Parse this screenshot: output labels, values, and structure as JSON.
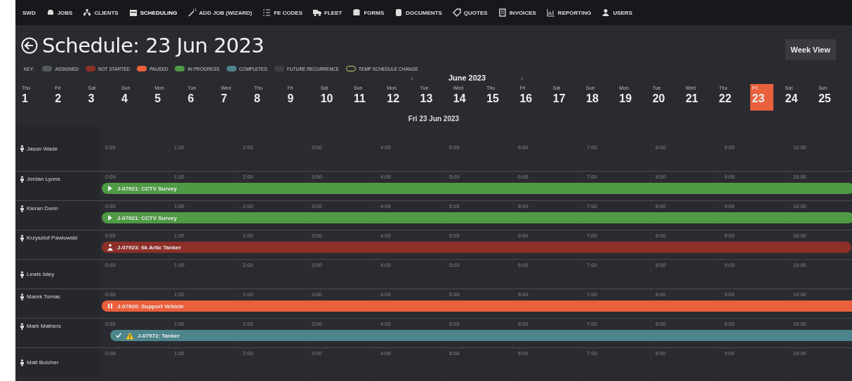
{
  "nav": {
    "brand": "SWD",
    "items": [
      {
        "label": "JOBS",
        "selected": false
      },
      {
        "label": "CLIENTS",
        "selected": false
      },
      {
        "label": "SCHEDULING",
        "selected": true
      },
      {
        "label": "ADD JOB (WIZARD)",
        "selected": false
      },
      {
        "label": "FE CODES",
        "selected": false
      },
      {
        "label": "FLEET",
        "selected": false
      },
      {
        "label": "FORMS",
        "selected": false
      },
      {
        "label": "DOCUMENTS",
        "selected": false
      },
      {
        "label": "QUOTES",
        "selected": false
      },
      {
        "label": "INVOICES",
        "selected": false
      },
      {
        "label": "REPORTING",
        "selected": false
      },
      {
        "label": "USERS",
        "selected": false
      }
    ]
  },
  "header": {
    "title": "Schedule: 23 Jun 2023",
    "view_button": "Week View"
  },
  "legend": {
    "label": "KEY:",
    "items": [
      {
        "label": "ASSIGNED",
        "kind": "fill",
        "color": "#55585e"
      },
      {
        "label": "NOT STARTED",
        "kind": "fill",
        "color": "#8e2f28"
      },
      {
        "label": "PAUSED",
        "kind": "fill",
        "color": "#ea5f3c"
      },
      {
        "label": "IN PROGRESS",
        "kind": "fill",
        "color": "#4f9a45"
      },
      {
        "label": "COMPLETED",
        "kind": "fill",
        "color": "#4d858c"
      },
      {
        "label": "FUTURE RECURRENCE",
        "kind": "fill",
        "color": "#3e4046"
      },
      {
        "label": "TEMP SCHEDULE CHANGE",
        "kind": "outline",
        "color": "#c9c86a"
      }
    ]
  },
  "calendar": {
    "month": "June 2023",
    "prev": "‹",
    "next": "›",
    "days": [
      {
        "weekday": "Thu",
        "day": "1",
        "selected": false
      },
      {
        "weekday": "Fri",
        "day": "2",
        "selected": false
      },
      {
        "weekday": "Sat",
        "day": "3",
        "selected": false
      },
      {
        "weekday": "Sun",
        "day": "4",
        "selected": false
      },
      {
        "weekday": "Mon",
        "day": "5",
        "selected": false
      },
      {
        "weekday": "Tue",
        "day": "6",
        "selected": false
      },
      {
        "weekday": "Wed",
        "day": "7",
        "selected": false
      },
      {
        "weekday": "Thu",
        "day": "8",
        "selected": false
      },
      {
        "weekday": "Fri",
        "day": "9",
        "selected": false
      },
      {
        "weekday": "Sat",
        "day": "10",
        "selected": false
      },
      {
        "weekday": "Sun",
        "day": "11",
        "selected": false
      },
      {
        "weekday": "Mon",
        "day": "12",
        "selected": false
      },
      {
        "weekday": "Tue",
        "day": "13",
        "selected": false
      },
      {
        "weekday": "Wed",
        "day": "14",
        "selected": false
      },
      {
        "weekday": "Thu",
        "day": "15",
        "selected": false
      },
      {
        "weekday": "Fri",
        "day": "16",
        "selected": false
      },
      {
        "weekday": "Sat",
        "day": "17",
        "selected": false
      },
      {
        "weekday": "Sun",
        "day": "18",
        "selected": false
      },
      {
        "weekday": "Mon",
        "day": "19",
        "selected": false
      },
      {
        "weekday": "Tue",
        "day": "20",
        "selected": false
      },
      {
        "weekday": "Wed",
        "day": "21",
        "selected": false
      },
      {
        "weekday": "Thu",
        "day": "22",
        "selected": false
      },
      {
        "weekday": "Fri",
        "day": "23",
        "selected": true
      },
      {
        "weekday": "Sat",
        "day": "24",
        "selected": false
      },
      {
        "weekday": "Sun",
        "day": "25",
        "selected": false
      }
    ],
    "date_label": "Fri 23 Jun 2023"
  },
  "rows": [
    {
      "name": "Jason Wade",
      "hours": [
        "0:00",
        "1:00",
        "2:00",
        "3:00",
        "4:00",
        "5:00",
        "6:00",
        "7:00",
        "8:00",
        "9:00",
        "10:00"
      ]
    },
    {
      "name": "Jordan Lyons",
      "hours": [
        "0:00",
        "1:00",
        "2:00",
        "3:00",
        "4:00",
        "5:00",
        "6:00",
        "7:00",
        "8:00",
        "9:00",
        "10:00"
      ],
      "job": {
        "label": "J-07921: CCTV Survey",
        "kind": "in_progress",
        "warning": false
      }
    },
    {
      "name": "Kieran Dunn",
      "hours": [
        "0:00",
        "1:00",
        "2:00",
        "3:00",
        "4:00",
        "5:00",
        "6:00",
        "7:00",
        "8:00",
        "9:00",
        "10:00"
      ],
      "job": {
        "label": "J-07921: CCTV Survey",
        "kind": "in_progress",
        "warning": false
      }
    },
    {
      "name": "Krzysztof Pawlowski",
      "hours": [
        "0:00",
        "1:00",
        "2:00",
        "3:00",
        "4:00",
        "5:00",
        "6:00",
        "7:00",
        "8:00",
        "9:00",
        "10:00"
      ],
      "job": {
        "label": "J-07923: 6k Artic Tanker",
        "kind": "not_started",
        "warning": false
      }
    },
    {
      "name": "Lewis Isley",
      "hours": [
        "0:00",
        "1:00",
        "2:00",
        "3:00",
        "4:00",
        "5:00",
        "6:00",
        "7:00",
        "8:00",
        "9:00",
        "10:00"
      ]
    },
    {
      "name": "Marek Tomas",
      "hours": [
        "0:00",
        "1:00",
        "2:00",
        "3:00",
        "4:00",
        "5:00",
        "6:00",
        "7:00",
        "8:00",
        "9:00",
        "10:00"
      ],
      "job": {
        "label": "J-07920: Support Vehicle",
        "kind": "paused",
        "warning": false
      }
    },
    {
      "name": "Mark Mathers",
      "hours": [
        "0:00",
        "1:00",
        "2:00",
        "3:00",
        "4:00",
        "5:00",
        "6:00",
        "7:00",
        "8:00",
        "9:00",
        "10:00"
      ],
      "job": {
        "label": "J-07972: Tanker",
        "kind": "completed",
        "warning": true
      }
    },
    {
      "name": "Matt Butcher",
      "hours": [
        "0:00",
        "1:00",
        "2:00",
        "3:00",
        "4:00",
        "5:00",
        "6:00",
        "7:00",
        "8:00",
        "9:00",
        "10:00"
      ]
    }
  ]
}
